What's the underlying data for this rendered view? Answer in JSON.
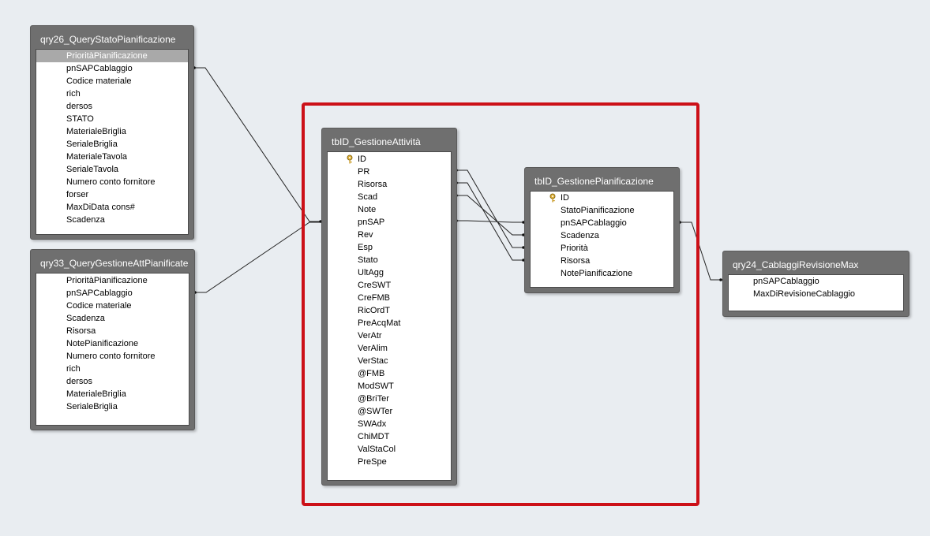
{
  "tables": {
    "qry26": {
      "title": "qry26_QueryStatoPianificazione",
      "fields": [
        "PrioritàPianificazione",
        "pnSAPCablaggio",
        "Codice materiale",
        "rich",
        "dersos",
        "STATO",
        "MaterialeBriglia",
        "SerialeBriglia",
        "MaterialeTavola",
        "SerialeTavola",
        "Numero conto fornitore",
        "forser",
        "MaxDiData cons#",
        "Scadenza"
      ],
      "selected_field": "PrioritàPianificazione"
    },
    "qry33": {
      "title": "qry33_QueryGestioneAttPianificate",
      "fields": [
        "PrioritàPianificazione",
        "pnSAPCablaggio",
        "Codice materiale",
        "Scadenza",
        "Risorsa",
        "NotePianificazione",
        "Numero conto fornitore",
        "rich",
        "dersos",
        "MaterialeBriglia",
        "SerialeBriglia"
      ]
    },
    "attivita": {
      "title": "tbID_GestioneAttività",
      "fields": [
        "ID",
        "PR",
        "Risorsa",
        "Scad",
        "Note",
        "pnSAP",
        "Rev",
        "Esp",
        "Stato",
        "UltAgg",
        "CreSWT",
        "CreFMB",
        "RicOrdT",
        "PreAcqMat",
        "VerAtr",
        "VerAlim",
        "VerStac",
        "@FMB",
        "ModSWT",
        "@BriTer",
        "@SWTer",
        "SWAdx",
        "ChiMDT",
        "ValStaCol",
        "PreSpe"
      ],
      "key_field": "ID"
    },
    "pianificazione": {
      "title": "tbID_GestionePianificazione",
      "fields": [
        "ID",
        "StatoPianificazione",
        "pnSAPCablaggio",
        "Scadenza",
        "Priorità",
        "Risorsa",
        "NotePianificazione"
      ],
      "key_field": "ID"
    },
    "qry24": {
      "title": "qry24_CablaggiRevisioneMax",
      "fields": [
        "pnSAPCablaggio",
        "MaxDiRevisioneCablaggio"
      ]
    }
  },
  "icons": {
    "primary_key": "key-icon"
  },
  "colors": {
    "canvas": "#e9edf1",
    "table_frame": "#6f6f6f",
    "selection": "#a9a9a9",
    "highlight": "#cc1018",
    "join_line": "#222222"
  }
}
